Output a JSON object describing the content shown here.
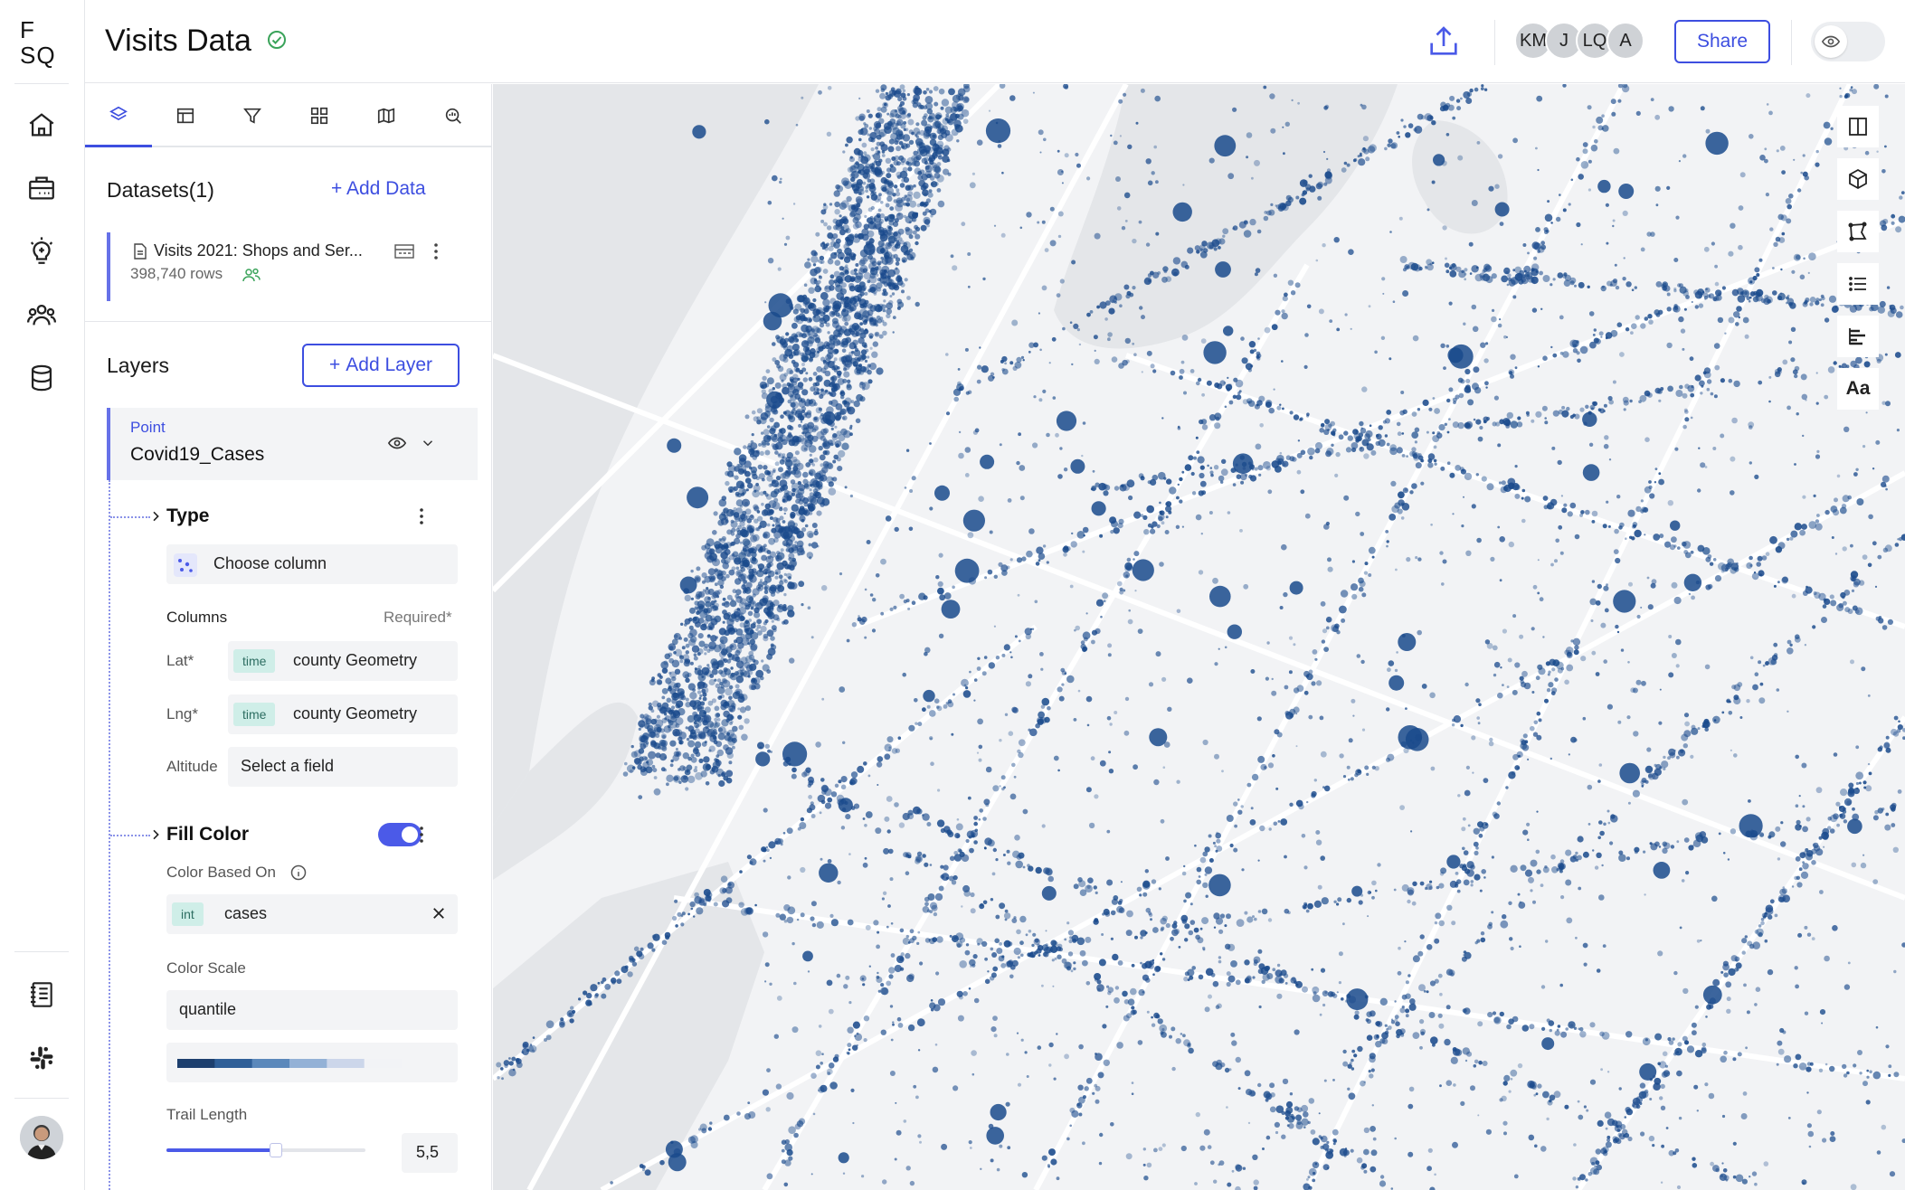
{
  "app": {
    "logo_top": "F",
    "logo_bottom": "SQ",
    "title": "Visits Data"
  },
  "header": {
    "collaborators": [
      "KM",
      "J",
      "LQ",
      "A"
    ],
    "share_label": "Share"
  },
  "rail": {
    "items": [
      "home-icon",
      "briefcase-icon",
      "lightbulb-icon",
      "users-icon",
      "database-icon"
    ],
    "bottom_items": [
      "notebook-icon",
      "slack-icon"
    ]
  },
  "panel": {
    "tabs": [
      "layers",
      "table",
      "filter",
      "interactions",
      "basemap",
      "search"
    ],
    "active_tab": "layers",
    "datasets": {
      "title": "Datasets(1)",
      "add_label": "Add Data",
      "items": [
        {
          "name": "Visits 2021: Shops and Ser...",
          "rows": "398,740 rows"
        }
      ]
    },
    "layers": {
      "title": "Layers",
      "add_label": "Add Layer",
      "items": [
        {
          "type": "Point",
          "name": "Covid19_Cases"
        }
      ]
    },
    "type_section": {
      "title": "Type",
      "choose_label": "Choose column",
      "columns_label": "Columns",
      "required_label": "Required*",
      "lat_label": "Lat*",
      "lat_type": "time",
      "lat_value": "county Geometry",
      "lng_label": "Lng*",
      "lng_type": "time",
      "lng_value": "county Geometry",
      "altitude_label": "Altitude",
      "altitude_placeholder": "Select a field"
    },
    "fill_color": {
      "title": "Fill Color",
      "enabled": true,
      "based_on_label": "Color Based On",
      "field_type": "int",
      "field_value": "cases",
      "scale_label": "Color Scale",
      "scale_value": "quantile",
      "palette": [
        "#1d3f6e",
        "#2f5f98",
        "#5b88bb",
        "#93b1d6",
        "#ccd6ea",
        "#f2f3f6"
      ]
    },
    "trail_length": {
      "label": "Trail Length",
      "value": "5,5",
      "fraction": 0.55
    }
  },
  "map": {
    "point_color": "#1a4a8c",
    "tools": [
      "split-map-icon",
      "3d-cube-icon",
      "draw-polygon-icon",
      "legend-list-icon",
      "bar-chart-icon",
      "label-text-icon"
    ],
    "label_tool_text": "Aa"
  },
  "colors": {
    "accent": "#3d4ee0",
    "map_background": "#f2f3f5",
    "roads": "#ffffff",
    "water": "#e6e8eb"
  }
}
